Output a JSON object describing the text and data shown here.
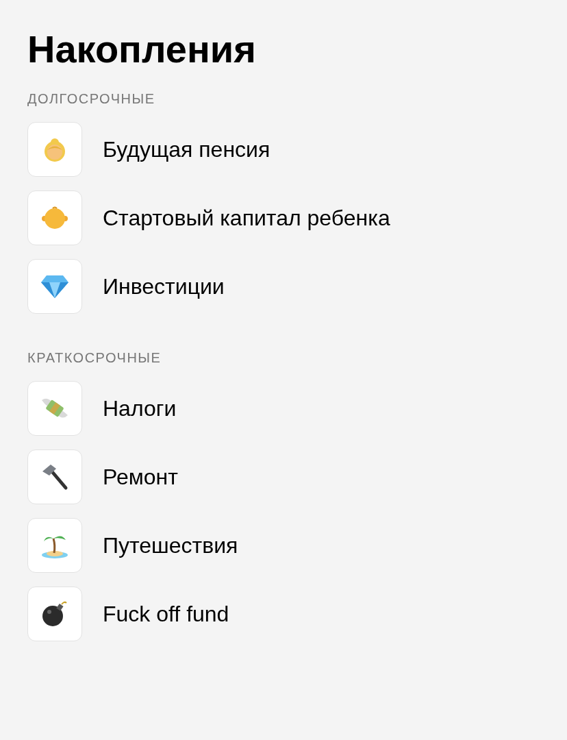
{
  "title": "Накопления",
  "sections": [
    {
      "heading": "ДОЛГОСРОЧНЫЕ",
      "items": [
        {
          "label": "Будущая пенсия"
        },
        {
          "label": "Стартовый капитал ребенка"
        },
        {
          "label": "Инвестиции"
        }
      ]
    },
    {
      "heading": "КРАТКОСРОЧНЫЕ",
      "items": [
        {
          "label": "Налоги"
        },
        {
          "label": "Ремонт"
        },
        {
          "label": "Путешествия"
        },
        {
          "label": "Fuck off fund"
        }
      ]
    }
  ]
}
